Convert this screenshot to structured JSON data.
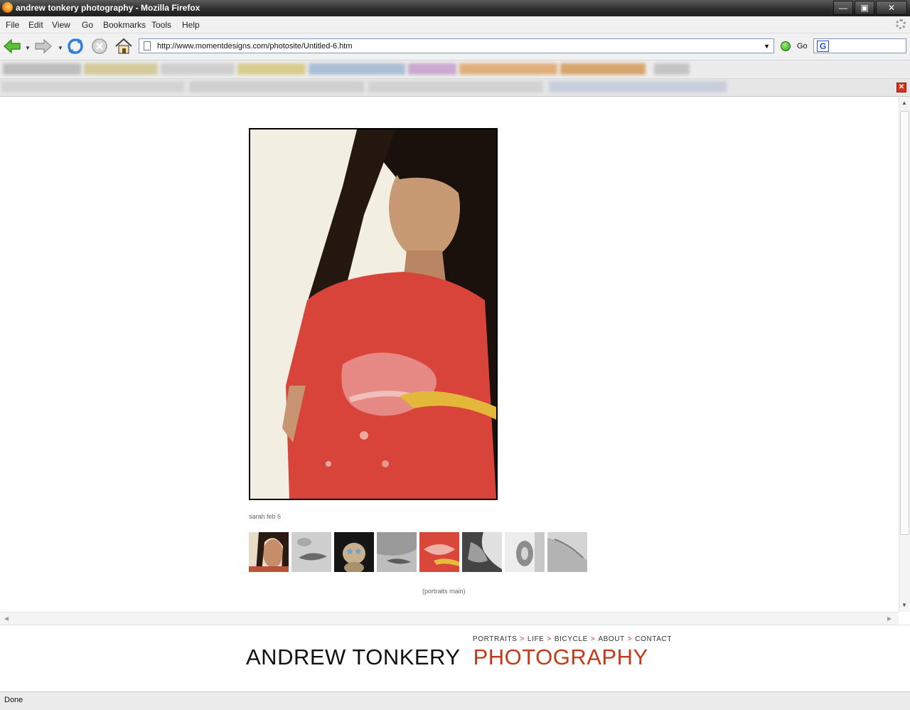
{
  "window": {
    "title": "andrew tonkery photography - Mozilla Firefox",
    "controls": [
      "—",
      "▣",
      "✕"
    ]
  },
  "menu": [
    "File",
    "Edit",
    "View",
    "Go",
    "Bookmarks",
    "Tools",
    "Help"
  ],
  "toolbar": {
    "url": "http://www.momentdesigns.com/photosite/Untitled-6.htm",
    "go_label": "Go"
  },
  "gallery": {
    "caption": "sarah feb 6",
    "thumbnails": [
      "portrait-woman",
      "lips-bw",
      "plush-toy",
      "face-bw",
      "lips-red",
      "profile-bw",
      "ear-bw",
      "neck-bw"
    ],
    "back_link": "(portraits main)"
  },
  "site_nav": [
    "PORTRAITS",
    "LIFE",
    "BICYCLE",
    "ABOUT",
    "CONTACT"
  ],
  "nav_separator": ">",
  "brand": {
    "name": "ANDREW TONKERY",
    "accent": "PHOTOGRAPHY",
    "accent_color": "#c33a1a"
  },
  "status": "Done"
}
